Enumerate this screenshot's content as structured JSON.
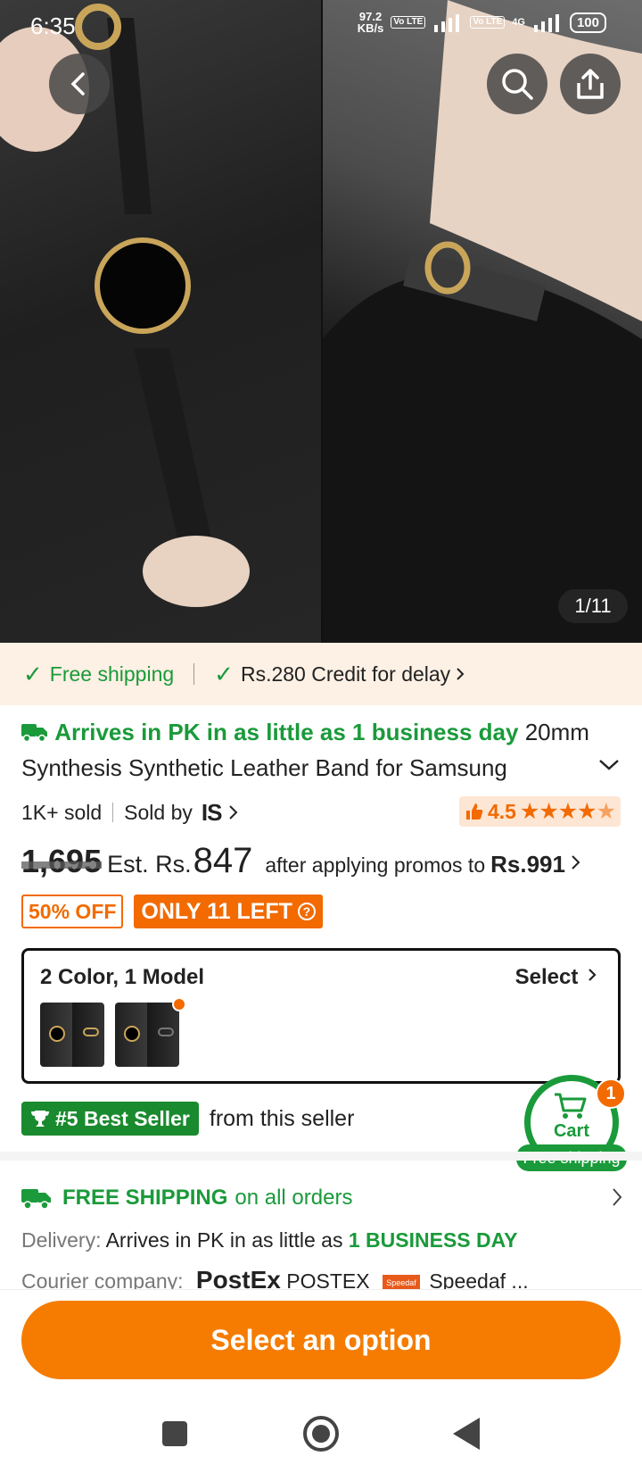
{
  "status_bar": {
    "time": "6:35",
    "net_speed_value": "97.2",
    "net_speed_unit": "KB/s",
    "volte1": "Vo LTE",
    "volte2": "Vo LTE",
    "network": "4G",
    "battery": "100"
  },
  "hero": {
    "image_counter": "1/11"
  },
  "shipping_banner": {
    "free_shipping": "Free shipping",
    "credit": "Rs.280 Credit for delay"
  },
  "product": {
    "arrival": "Arrives in PK in as little as 1 business day",
    "title": "20mm Synthesis Synthetic Leather Band for Samsung",
    "sold": "1K+ sold",
    "sold_by": "Sold by",
    "brand": "IS",
    "rating": "4.5",
    "original_price": "1,695",
    "est_label": "Est. Rs.",
    "est_price": "847",
    "promo_text": "after applying promos to",
    "promo_price": "Rs.991",
    "discount": "50% OFF",
    "stock": "ONLY 11 LEFT"
  },
  "variant": {
    "title": "2 Color, 1 Model",
    "select_label": "Select"
  },
  "best_seller": {
    "badge": "#5 Best Seller",
    "text": "from this seller"
  },
  "cart": {
    "label": "Cart",
    "count": "1",
    "free_shipping": "Free shipping"
  },
  "shipping_section": {
    "headline_bold": "FREE SHIPPING",
    "headline_rest": "on all orders",
    "delivery_label": "Delivery:",
    "delivery_text": "Arrives in PK in as little as",
    "delivery_strong": "1 BUSINESS DAY",
    "courier_label": "Courier company:",
    "courier1_logo": "PostEx",
    "courier1_name": "POSTEX",
    "courier2_logo": "Speedaf",
    "courier2_name": "Speedaf ..."
  },
  "bottom": {
    "select_button": "Select an option"
  },
  "colors": {
    "accent_orange": "#f57c00",
    "green": "#1a9a3a"
  }
}
